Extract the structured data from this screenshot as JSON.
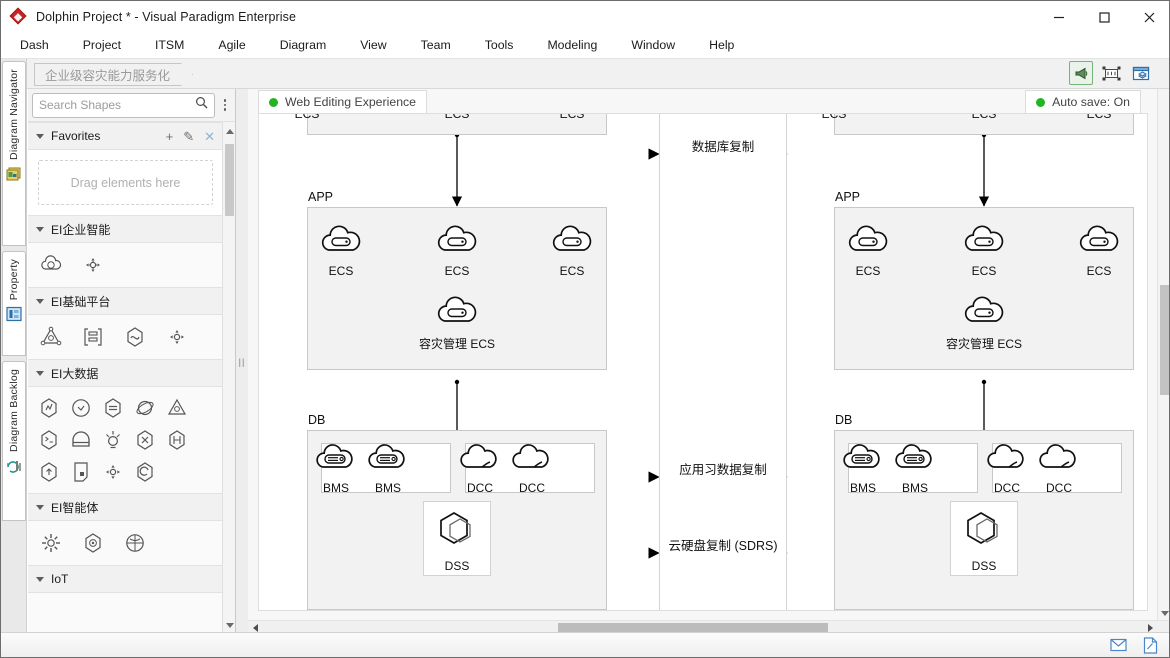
{
  "window": {
    "title": "Dolphin Project * - Visual Paradigm Enterprise",
    "app_icon": "diamond-logo-icon",
    "minimize_label": "—",
    "maximize_label": "□",
    "close_label": "✕"
  },
  "menubar": {
    "items": [
      {
        "label": "Dash"
      },
      {
        "label": "Project"
      },
      {
        "label": "ITSM"
      },
      {
        "label": "Agile"
      },
      {
        "label": "Diagram"
      },
      {
        "label": "View"
      },
      {
        "label": "Team"
      },
      {
        "label": "Tools"
      },
      {
        "label": "Modeling"
      },
      {
        "label": "Window"
      },
      {
        "label": "Help"
      }
    ]
  },
  "tabstrip": {
    "diagram_tab_label": "企业级容灾能力服务化",
    "icons": [
      {
        "name": "announce-icon",
        "selected": true
      },
      {
        "name": "fit-to-window-icon",
        "selected": false
      },
      {
        "name": "layers-window-icon",
        "selected": false
      }
    ]
  },
  "rail": {
    "tabs": [
      {
        "label": "Diagram Navigator",
        "icon": "diagram-navigator-icon"
      },
      {
        "label": "Property",
        "icon": "property-icon"
      },
      {
        "label": "Diagram Backlog",
        "icon": "diagram-backlog-icon"
      }
    ]
  },
  "shapes_panel": {
    "search": {
      "placeholder": "Search Shapes",
      "value": "",
      "icon": "search-icon"
    },
    "more_icon": "kebab-menu-icon",
    "groups": [
      {
        "label": "Favorites",
        "expanded": true,
        "has_actions": true,
        "add_label": "+",
        "edit_label": "✎",
        "close_label": "✕",
        "dropzone_text": "Drag elements here",
        "shapes": []
      },
      {
        "label": "EI企业智能",
        "expanded": true,
        "has_actions": false,
        "shapes": [
          {
            "name": "cloud-face-icon"
          },
          {
            "name": "node-cluster-icon"
          }
        ]
      },
      {
        "label": "EI基础平台",
        "expanded": true,
        "has_actions": false,
        "shapes": [
          {
            "name": "triangle-net-icon"
          },
          {
            "name": "framed-list-icon"
          },
          {
            "name": "hexagon-wave-icon"
          },
          {
            "name": "node-cluster-icon"
          }
        ]
      },
      {
        "label": "EI大数据",
        "expanded": true,
        "has_actions": false,
        "shapes": [
          {
            "name": "hex-chart-icon"
          },
          {
            "name": "circle-arrow-icon"
          },
          {
            "name": "hex-equal-icon"
          },
          {
            "name": "globe-orbit-icon"
          },
          {
            "name": "triangle-net-icon"
          },
          {
            "name": "hex-terminal-icon"
          },
          {
            "name": "arch-box-icon"
          },
          {
            "name": "bulb-gear-icon"
          },
          {
            "name": "hex-cross-icon"
          },
          {
            "name": "hex-bracket-icon"
          },
          {
            "name": "hex-upload-icon"
          },
          {
            "name": "document-note-icon"
          },
          {
            "name": "node-cluster-icon"
          },
          {
            "name": "hex-loop-icon"
          }
        ]
      },
      {
        "label": "EI智能体",
        "expanded": true,
        "has_actions": false,
        "shapes": [
          {
            "name": "spark-burst-icon"
          },
          {
            "name": "hex-brain-icon"
          },
          {
            "name": "globe-target-icon"
          }
        ]
      },
      {
        "label": "IoT",
        "expanded": true,
        "has_actions": false,
        "shapes": []
      }
    ]
  },
  "canvas": {
    "web_editing_badge": {
      "label": "Web Editing Experience",
      "status_color": "#22b422"
    },
    "auto_save_badge": {
      "label": "Auto save: On",
      "status_color": "#22b422"
    }
  },
  "diagram": {
    "left_site": {
      "top_cut_labels": [
        "ECS",
        "ECS",
        "ECS"
      ],
      "app": {
        "label": "APP",
        "nodes": [
          {
            "label": "ECS",
            "icon": "cloud-server-icon"
          },
          {
            "label": "ECS",
            "icon": "cloud-server-icon"
          },
          {
            "label": "ECS",
            "icon": "cloud-server-icon"
          }
        ],
        "manager": {
          "label": "容灾管理 ECS",
          "icon": "cloud-server-icon"
        }
      },
      "db": {
        "label": "DB",
        "bms_group": [
          {
            "label": "BMS",
            "icon": "cloud-bms-icon"
          },
          {
            "label": "BMS",
            "icon": "cloud-bms-icon"
          }
        ],
        "dcc_group": [
          {
            "label": "DCC",
            "icon": "cloud-dcc-icon"
          },
          {
            "label": "DCC",
            "icon": "cloud-dcc-icon"
          }
        ],
        "dss": {
          "label": "DSS",
          "icon": "hexagon-dss-icon"
        }
      }
    },
    "right_site": {
      "top_cut_labels": [
        "ECS",
        "ECS",
        "ECS"
      ],
      "app": {
        "label": "APP",
        "nodes": [
          {
            "label": "ECS",
            "icon": "cloud-server-icon"
          },
          {
            "label": "ECS",
            "icon": "cloud-server-icon"
          },
          {
            "label": "ECS",
            "icon": "cloud-server-icon"
          }
        ],
        "manager": {
          "label": "容灾管理 ECS",
          "icon": "cloud-server-icon"
        }
      },
      "db": {
        "label": "DB",
        "bms_group": [
          {
            "label": "BMS",
            "icon": "cloud-bms-icon"
          },
          {
            "label": "BMS",
            "icon": "cloud-bms-icon"
          }
        ],
        "dcc_group": [
          {
            "label": "DCC",
            "icon": "cloud-dcc-icon"
          },
          {
            "label": "DCC",
            "icon": "cloud-dcc-icon"
          }
        ],
        "dss": {
          "label": "DSS",
          "icon": "hexagon-dss-icon"
        }
      }
    },
    "replication_links": [
      {
        "label": "数据库复制"
      },
      {
        "label": "应用习数据复制"
      },
      {
        "label": "云硬盘复制 (SDRS)"
      }
    ]
  },
  "statusbar": {
    "icons": [
      {
        "name": "mail-icon"
      },
      {
        "name": "note-edit-icon"
      }
    ]
  }
}
